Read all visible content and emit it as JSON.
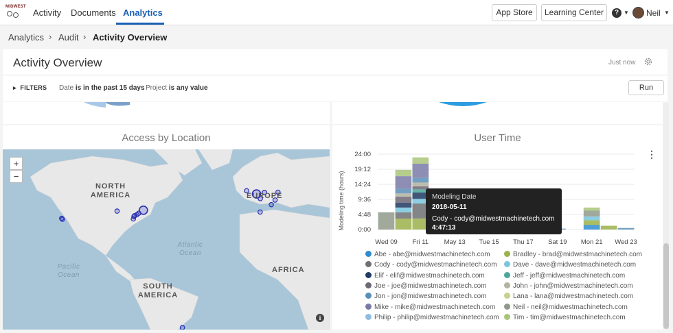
{
  "nav": {
    "logo_text": "MIDWEST",
    "links": [
      "Activity",
      "Documents",
      "Analytics"
    ],
    "app_store": "App Store",
    "learning_center": "Learning Center",
    "help_glyph": "?",
    "user_name": "Neil"
  },
  "breadcrumb": {
    "items": [
      "Analytics",
      "Audit",
      "Activity Overview"
    ]
  },
  "header": {
    "title": "Activity Overview",
    "refreshed": "Just now",
    "filters_label": "FILTERS",
    "filter_date_key": "Date",
    "filter_date_value": "is in the past 15 days",
    "filter_project_key": "Project",
    "filter_project_value": "is any value",
    "run_label": "Run"
  },
  "access_panel": {
    "title": "Access by Location",
    "zoom_in": "+",
    "zoom_out": "−",
    "info_glyph": "i",
    "labels": {
      "north_america": "NORTH AMERICA",
      "europe": "EUROPE",
      "atlantic": "Atlantic Ocean",
      "pacific": "Pacific Ocean",
      "africa": "AFRICA",
      "south_america": "SOUTH AMERICA"
    }
  },
  "user_time_panel": {
    "title": "User Time",
    "kebab_glyph": "⋮"
  },
  "chart_data": {
    "type": "bar",
    "stacked": true,
    "title": "User Time",
    "ylabel": "Modeling time (hours)",
    "xlabel": "",
    "ylim": [
      0,
      24
    ],
    "yticks": [
      "24:00",
      "19:12",
      "14:24",
      "9:36",
      "4:48",
      "0:00"
    ],
    "xticks": [
      "Wed 09",
      "Fri 11",
      "May 13",
      "Tue 15",
      "Thu 17",
      "Sat 19",
      "Mon 21",
      "Wed 23"
    ],
    "categories": [
      "May 09",
      "May 10",
      "May 11",
      "May 12",
      "May 13",
      "May 14",
      "May 15",
      "May 16",
      "May 17",
      "May 18",
      "May 19",
      "May 20",
      "May 21",
      "May 22",
      "May 23"
    ],
    "series": [
      {
        "name": "Abe - abe@midwestmachinetech.com",
        "color": "#2e8ccf",
        "values": [
          0,
          0,
          0,
          0,
          0,
          0,
          0,
          0,
          0,
          0,
          0,
          0,
          1.5,
          0,
          0
        ]
      },
      {
        "name": "Bradley - brad@midwestmachinetech.com",
        "color": "#9bb24a",
        "values": [
          0,
          3.5,
          3.5,
          0,
          0,
          0,
          0,
          0,
          0,
          0,
          0,
          0,
          1.5,
          1.2,
          0
        ]
      },
      {
        "name": "Cody - cody@midwestmachinetech.com",
        "color": "#6f7072",
        "values": [
          0,
          2.0,
          4.78,
          0,
          0,
          0,
          0,
          0,
          0,
          0,
          0,
          0,
          0,
          0,
          0
        ]
      },
      {
        "name": "Dave - dave@midwestmachinetech.com",
        "color": "#78c6dd",
        "values": [
          0,
          1.5,
          1.5,
          0,
          0,
          0,
          0,
          0,
          0,
          0,
          0,
          0,
          1.2,
          0,
          0
        ]
      },
      {
        "name": "Elif - elif@midwestmachinetech.com",
        "color": "#1f3a63",
        "values": [
          0,
          1.5,
          2.0,
          0,
          0,
          0,
          0,
          0,
          0,
          0,
          0,
          0,
          0,
          0,
          0
        ]
      },
      {
        "name": "Jeff - jeff@midwestmachinetech.com",
        "color": "#4aa79a",
        "values": [
          0,
          0,
          1.0,
          0,
          0,
          0,
          0,
          0,
          0,
          0,
          0,
          0,
          0,
          0,
          0
        ]
      },
      {
        "name": "Joe - joe@midwestmachinetech.com",
        "color": "#6d6875",
        "values": [
          0,
          2.0,
          1.0,
          0,
          0,
          0,
          0,
          0,
          0,
          0,
          0,
          0,
          0,
          0,
          0
        ]
      },
      {
        "name": "John - john@midwestmachinetech.com",
        "color": "#b3b3a0",
        "values": [
          0,
          1.0,
          1.2,
          0,
          0,
          0,
          0,
          0,
          0,
          0,
          0,
          0,
          0,
          0,
          0
        ]
      },
      {
        "name": "Jon - jon@midwestmachinetech.com",
        "color": "#5a8fb7",
        "values": [
          0,
          1.5,
          1.5,
          0,
          0,
          0,
          0,
          0,
          0,
          0,
          0.3,
          0,
          0,
          0,
          0.5
        ]
      },
      {
        "name": "Lana - lana@midwestmachinetech.com",
        "color": "#c9cf8e",
        "values": [
          0,
          0,
          0,
          0,
          0,
          0,
          0,
          0,
          0,
          0,
          0,
          0,
          0,
          0,
          0
        ]
      },
      {
        "name": "Mike - mike@midwestmachinetech.com",
        "color": "#7a7aa8",
        "values": [
          0,
          4.0,
          4.5,
          0,
          0,
          0,
          0,
          0,
          0,
          0,
          0,
          0,
          0,
          0,
          0
        ]
      },
      {
        "name": "Neil - neil@midwestmachinetech.com",
        "color": "#8f9a8a",
        "values": [
          5.5,
          0,
          0,
          0,
          0,
          0,
          0,
          0,
          0,
          0,
          0,
          0,
          1.8,
          0,
          0
        ]
      },
      {
        "name": "Philip - philip@midwestmachinetech.com",
        "color": "#8fbce0",
        "values": [
          0,
          0,
          0,
          0,
          0,
          0,
          0,
          0,
          0,
          0,
          0,
          0,
          0,
          0,
          0
        ]
      },
      {
        "name": "Tim - tim@midwestmachinetech.com",
        "color": "#a9c47a",
        "values": [
          0,
          2.0,
          2.0,
          0,
          0,
          0,
          0,
          0,
          0,
          0,
          0,
          0,
          1.0,
          0,
          0
        ]
      }
    ],
    "tooltip": {
      "heading": "Modeling Date",
      "date": "2018-05-11",
      "series": "Cody - cody@midwestmachinetech.com",
      "value": "4:47:13"
    },
    "legend_placement": "bottom",
    "grid": true
  },
  "map_points": [
    {
      "name": "san-francisco",
      "lon": -122.4,
      "lat": 37.8
    },
    {
      "name": "san-jose",
      "lon": -121.9,
      "lat": 37.3
    },
    {
      "name": "chicago",
      "lon": -87.6,
      "lat": 41.9
    },
    {
      "name": "boston",
      "lon": -71.1,
      "lat": 42.4
    },
    {
      "name": "new-york",
      "lon": -74.0,
      "lat": 40.7
    },
    {
      "name": "philadelphia",
      "lon": -75.2,
      "lat": 39.9
    },
    {
      "name": "baltimore",
      "lon": -76.6,
      "lat": 39.3
    },
    {
      "name": "washington",
      "lon": -77.0,
      "lat": 38.9
    },
    {
      "name": "richmond",
      "lon": -77.4,
      "lat": 37.5
    },
    {
      "name": "london",
      "lon": -0.1,
      "lat": 51.5
    },
    {
      "name": "dublin",
      "lon": -6.3,
      "lat": 53.3
    },
    {
      "name": "amsterdam",
      "lon": 4.9,
      "lat": 52.4
    },
    {
      "name": "paris",
      "lon": 2.3,
      "lat": 48.9
    },
    {
      "name": "munich",
      "lon": 11.6,
      "lat": 48.1
    },
    {
      "name": "berlin",
      "lon": 13.4,
      "lat": 52.5
    },
    {
      "name": "barcelona",
      "lon": 2.2,
      "lat": 41.4
    },
    {
      "name": "milan",
      "lon": 9.2,
      "lat": 45.5
    },
    {
      "name": "sao-paulo",
      "lon": -46.6,
      "lat": -23.5
    }
  ]
}
